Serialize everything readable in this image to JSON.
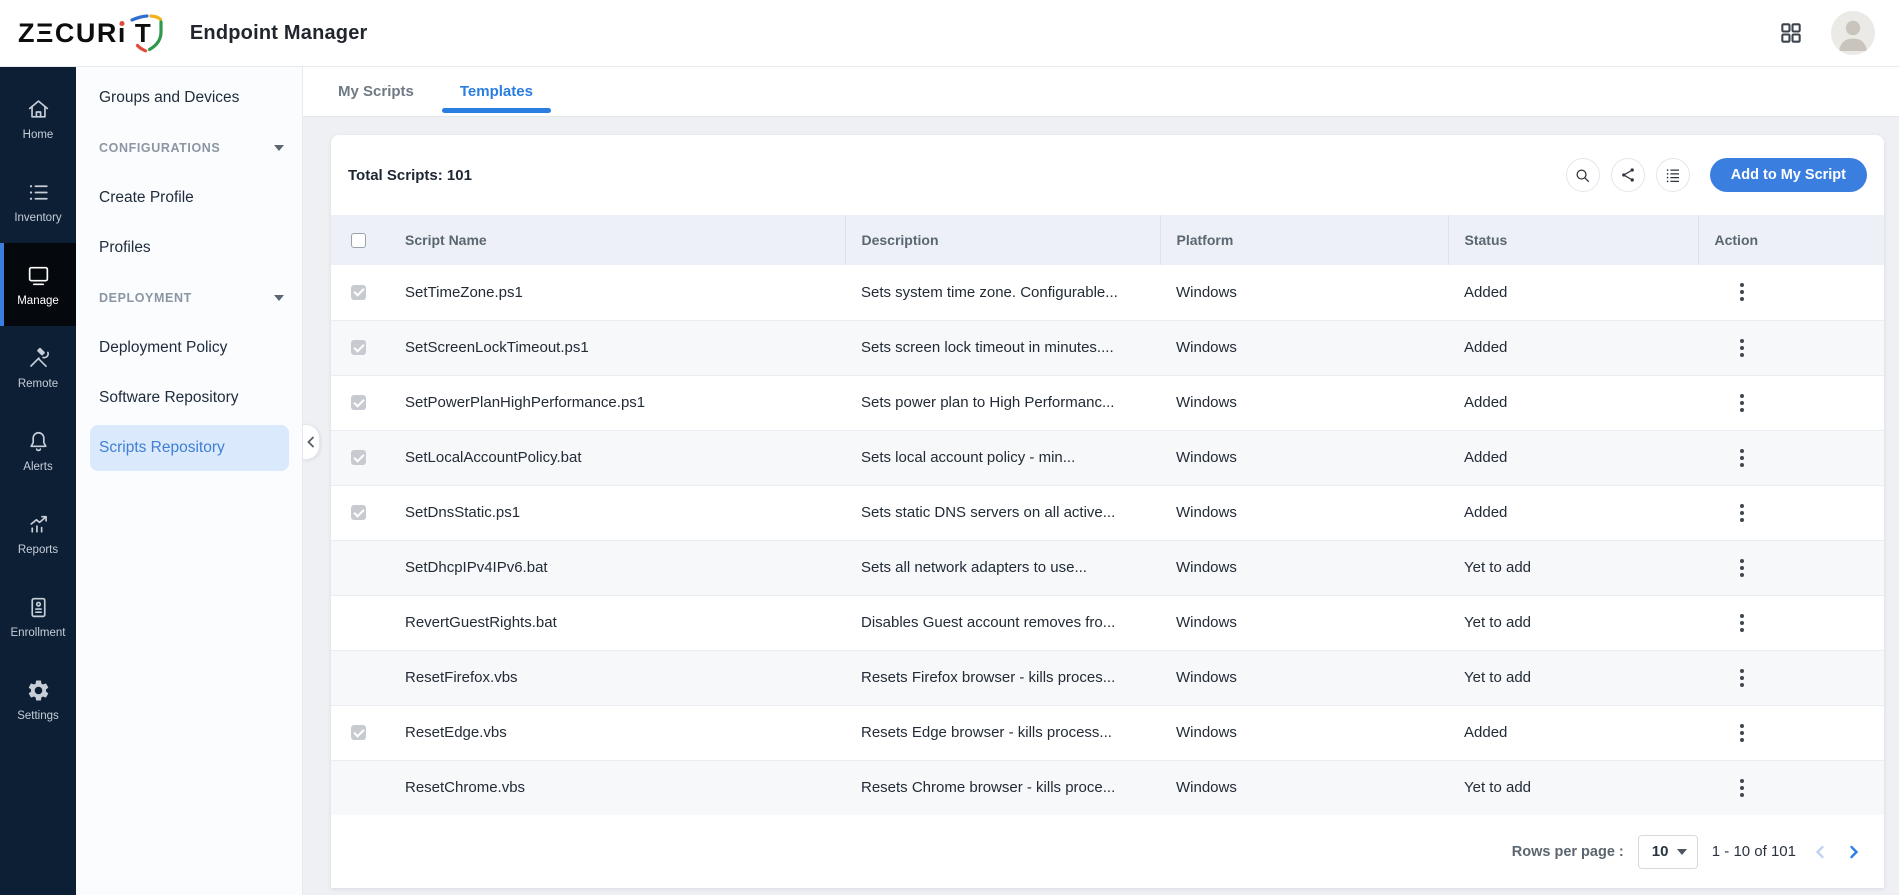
{
  "brand": {
    "wordmark_left": "ZΞCUR",
    "wordmark_i": "i",
    "wordmark_t": "T",
    "product": "Endpoint Manager"
  },
  "nav_rail": {
    "items": [
      {
        "label": "Home",
        "icon": "home-icon",
        "active": false
      },
      {
        "label": "Inventory",
        "icon": "list-icon",
        "active": false
      },
      {
        "label": "Manage",
        "icon": "monitor-icon",
        "active": true
      },
      {
        "label": "Remote",
        "icon": "tools-icon",
        "active": false
      },
      {
        "label": "Alerts",
        "icon": "bell-icon",
        "active": false
      },
      {
        "label": "Reports",
        "icon": "chart-icon",
        "active": false
      },
      {
        "label": "Enrollment",
        "icon": "enrollment-icon",
        "active": false
      },
      {
        "label": "Settings",
        "icon": "gear-icon",
        "active": false
      }
    ]
  },
  "sidebar": {
    "items": [
      {
        "type": "link",
        "label": "Groups and Devices",
        "active": false
      },
      {
        "type": "section",
        "label": "CONFIGURATIONS"
      },
      {
        "type": "link",
        "label": "Create Profile",
        "active": false
      },
      {
        "type": "link",
        "label": "Profiles",
        "active": false
      },
      {
        "type": "section",
        "label": "DEPLOYMENT"
      },
      {
        "type": "link",
        "label": "Deployment Policy",
        "active": false
      },
      {
        "type": "link",
        "label": "Software Repository",
        "active": false
      },
      {
        "type": "link",
        "label": "Scripts Repository",
        "active": true
      }
    ]
  },
  "tabs": [
    {
      "label": "My Scripts",
      "active": false
    },
    {
      "label": "Templates",
      "active": true
    }
  ],
  "toolbar": {
    "total_scripts": "Total Scripts: 101",
    "buttons": [
      {
        "icon": "search-icon"
      },
      {
        "icon": "share-icon"
      },
      {
        "icon": "list-view-icon"
      }
    ],
    "add_button_label": "Add to My Script"
  },
  "table": {
    "columns": [
      "Script Name",
      "Description",
      "Platform",
      "Status",
      "Action"
    ],
    "rows": [
      {
        "checked": true,
        "name": "SetTimeZone.ps1",
        "description": "Sets system time zone. Configurable...",
        "platform": "Windows",
        "status": "Added"
      },
      {
        "checked": true,
        "name": "SetScreenLockTimeout.ps1",
        "description": "Sets screen lock timeout in minutes....",
        "platform": "Windows",
        "status": "Added"
      },
      {
        "checked": true,
        "name": "SetPowerPlanHighPerformance.ps1",
        "description": "Sets power plan to High Performanc...",
        "platform": "Windows",
        "status": "Added"
      },
      {
        "checked": true,
        "name": "SetLocalAccountPolicy.bat",
        "description": "Sets local account policy - min...",
        "platform": "Windows",
        "status": "Added"
      },
      {
        "checked": true,
        "name": "SetDnsStatic.ps1",
        "description": "Sets static DNS servers on all active...",
        "platform": "Windows",
        "status": "Added"
      },
      {
        "checked": false,
        "name": "SetDhcpIPv4IPv6.bat",
        "description": "Sets all network adapters to use...",
        "platform": "Windows",
        "status": "Yet to add"
      },
      {
        "checked": false,
        "name": "RevertGuestRights.bat",
        "description": "Disables Guest account removes fro...",
        "platform": "Windows",
        "status": "Yet to add"
      },
      {
        "checked": false,
        "name": "ResetFirefox.vbs",
        "description": "Resets Firefox browser - kills proces...",
        "platform": "Windows",
        "status": "Yet to add"
      },
      {
        "checked": true,
        "name": "ResetEdge.vbs",
        "description": "Resets Edge browser - kills process...",
        "platform": "Windows",
        "status": "Added"
      },
      {
        "checked": false,
        "name": "ResetChrome.vbs",
        "description": "Resets Chrome browser - kills proce...",
        "platform": "Windows",
        "status": "Yet to add"
      }
    ]
  },
  "pagination": {
    "rows_per_page_label": "Rows per page :",
    "rows_per_page_value": "10",
    "range_text": "1 - 10 of 101"
  },
  "colors": {
    "accent_blue": "#3a7fe0",
    "tab_active_blue": "#2a7de1",
    "rail_bg": "#0c1f35",
    "rail_active_bg": "#05080d",
    "selected_nav_bg": "#dbe9fc",
    "selected_nav_text": "#3f7fd4",
    "table_header_bg": "#edf1f7",
    "row_alt_bg": "#f7f8fa"
  }
}
